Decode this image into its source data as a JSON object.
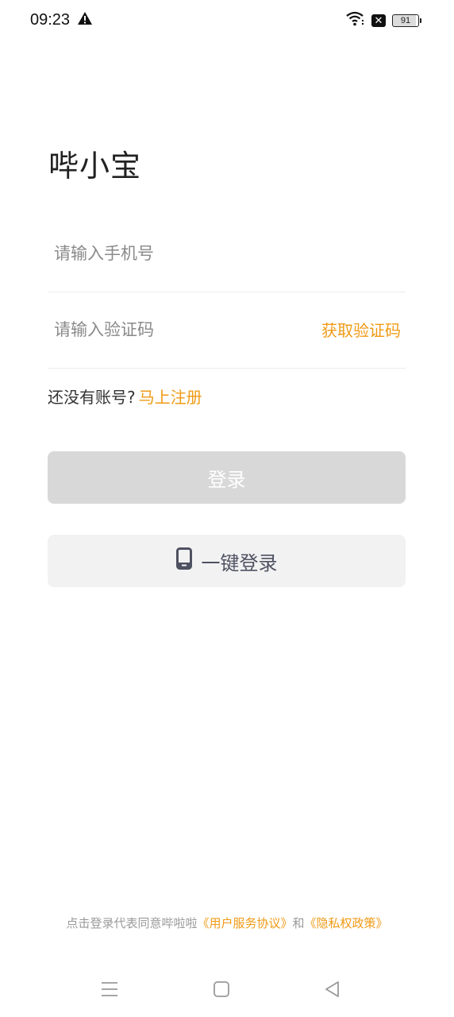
{
  "status_bar": {
    "time": "09:23",
    "battery": "91",
    "icons": [
      "warning-icon",
      "wifi-icon",
      "close-badge-icon",
      "battery-icon"
    ]
  },
  "app": {
    "title": "哔小宝"
  },
  "form": {
    "phone_placeholder": "请输入手机号",
    "code_placeholder": "请输入验证码",
    "get_code_label": "获取验证码"
  },
  "register": {
    "prompt": "还没有账号?",
    "link": "马上注册"
  },
  "buttons": {
    "login": "登录",
    "one_key_login": "一键登录",
    "one_key_icon": "phone-icon"
  },
  "agreement": {
    "prefix": "点击登录代表同意哔啦啦",
    "terms": "《用户服务协议》",
    "and": "和",
    "privacy": "《隐私权政策》"
  },
  "nav": {
    "icons": [
      "menu-icon",
      "home-icon",
      "back-icon"
    ]
  },
  "colors": {
    "accent": "#f09a16",
    "login_disabled": "#d8d8d8",
    "secondary_button": "#f2f2f3"
  }
}
